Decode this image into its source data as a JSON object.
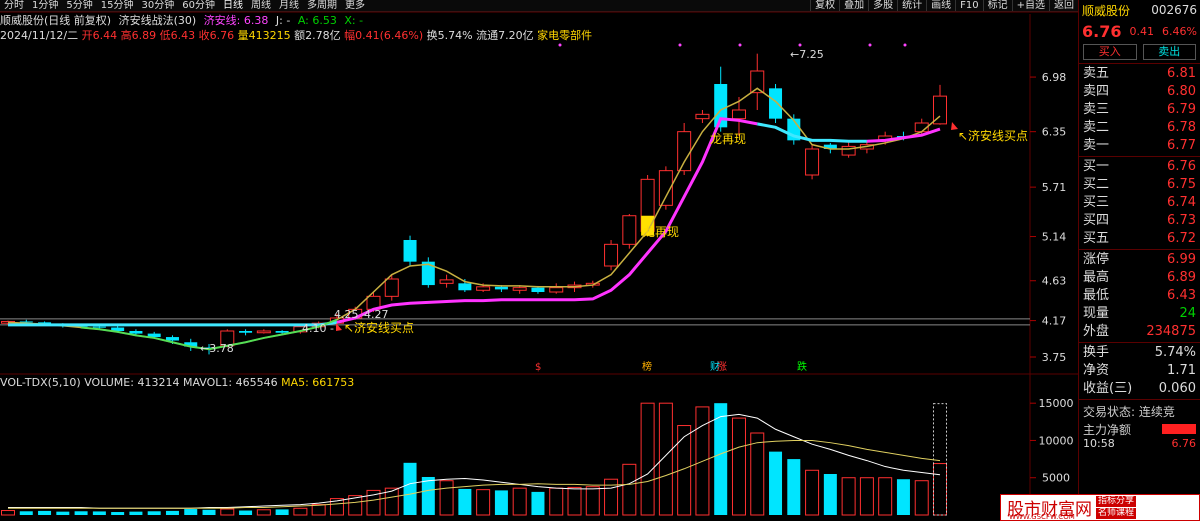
{
  "menu": {
    "tabs": [
      "分时",
      "1分钟",
      "5分钟",
      "15分钟",
      "30分钟",
      "60分钟",
      "日线",
      "周线",
      "月线",
      "多周期",
      "更多"
    ],
    "active": "日线",
    "right": [
      "复权",
      "叠加",
      "多股",
      "统计",
      "画线",
      "F10",
      "标记",
      "+自选",
      "返回"
    ]
  },
  "title": {
    "name": "顺威股份(日线 前复权)",
    "indicator": "济安线战法(30)",
    "jax_label": "济安线: 6.38",
    "j_label": "J: -",
    "a_label": "A: 6.53",
    "x_label": "X: -"
  },
  "info": {
    "date": "2024/11/12/二",
    "open": "开6.44",
    "high": "高6.89",
    "low": "低6.43",
    "close": "收6.76",
    "vol": "量413215",
    "amount": "额2.78亿",
    "change": "幅0.41(6.46%)",
    "turnover": "换5.74%",
    "float": "流通7.20亿",
    "sector": "家电零部件"
  },
  "vol_info": {
    "name": "VOL-TDX(5,10)",
    "volume": "VOLUME: 413214",
    "mavol1": "MAVOL1: 465546",
    "ma5": "MA5: 661753"
  },
  "colors": {
    "up": "#ff3030",
    "down": "#00e5ff",
    "jax": "#ff33ff",
    "ma": "#aaffaa",
    "green": "#33cc33",
    "grid": "#5a0000"
  },
  "chart_data": {
    "type": "candlestick",
    "price_ticks": [
      "6.98",
      "6.35",
      "5.71",
      "5.14",
      "4.63",
      "4.17",
      "3.75"
    ],
    "vol_ticks": [
      "15000",
      "10000",
      "5000"
    ],
    "annotations": {
      "high": "7.25",
      "low": "3.78",
      "mid1": "4.25",
      "mid2": "4.27",
      "low2": "4.10",
      "buy1": "济安线买点",
      "buy2": "济安线买点",
      "dragon1": "龙再现",
      "dragon2": "龙再现"
    },
    "event_marks": [
      {
        "t": "$",
        "c": "#ff3030"
      },
      {
        "t": "榜",
        "c": "#ffb000"
      },
      {
        "t": "财",
        "c": "#00e5ff"
      },
      {
        "t": "涨",
        "c": "#ff3030"
      },
      {
        "t": "跌",
        "c": "#00ff00"
      }
    ],
    "candles": [
      [
        4.14,
        4.16,
        4.12,
        4.17
      ],
      [
        4.16,
        4.15,
        4.13,
        4.18
      ],
      [
        4.15,
        4.13,
        4.11,
        4.16
      ],
      [
        4.13,
        4.11,
        4.09,
        4.14
      ],
      [
        4.11,
        4.1,
        4.08,
        4.13
      ],
      [
        4.1,
        4.09,
        4.07,
        4.12
      ],
      [
        4.09,
        4.05,
        4.04,
        4.11
      ],
      [
        4.05,
        4.02,
        4.0,
        4.07
      ],
      [
        4.02,
        3.98,
        3.97,
        4.04
      ],
      [
        3.98,
        3.94,
        3.9,
        4.0
      ],
      [
        3.92,
        3.87,
        3.82,
        3.96
      ],
      [
        3.86,
        3.84,
        3.78,
        3.9
      ],
      [
        3.88,
        4.05,
        3.86,
        4.07
      ],
      [
        4.05,
        4.03,
        4.0,
        4.07
      ],
      [
        4.03,
        4.05,
        4.02,
        4.07
      ],
      [
        4.05,
        4.03,
        4.01,
        4.06
      ],
      [
        4.04,
        4.1,
        4.02,
        4.12
      ],
      [
        4.1,
        4.14,
        4.08,
        4.16
      ],
      [
        4.14,
        4.2,
        4.1,
        4.25
      ],
      [
        4.2,
        4.3,
        4.18,
        4.33
      ],
      [
        4.3,
        4.45,
        4.27,
        4.5
      ],
      [
        4.45,
        4.65,
        4.4,
        4.7
      ],
      [
        5.1,
        4.85,
        4.8,
        5.15
      ],
      [
        4.85,
        4.58,
        4.55,
        4.9
      ],
      [
        4.6,
        4.64,
        4.55,
        4.7
      ],
      [
        4.6,
        4.52,
        4.5,
        4.65
      ],
      [
        4.52,
        4.56,
        4.5,
        4.6
      ],
      [
        4.56,
        4.53,
        4.5,
        4.58
      ],
      [
        4.52,
        4.55,
        4.48,
        4.58
      ],
      [
        4.55,
        4.5,
        4.48,
        4.57
      ],
      [
        4.5,
        4.55,
        4.48,
        4.6
      ],
      [
        4.55,
        4.58,
        4.5,
        4.62
      ],
      [
        4.58,
        4.6,
        4.55,
        4.63
      ],
      [
        4.8,
        5.05,
        4.75,
        5.1
      ],
      [
        5.05,
        5.38,
        5.0,
        5.4
      ],
      [
        5.2,
        5.8,
        5.15,
        5.85
      ],
      [
        5.5,
        5.9,
        5.45,
        5.95
      ],
      [
        5.9,
        6.35,
        5.85,
        6.45
      ],
      [
        6.5,
        6.55,
        6.45,
        6.6
      ],
      [
        6.9,
        6.4,
        6.35,
        7.1
      ],
      [
        6.5,
        6.6,
        6.3,
        6.75
      ],
      [
        6.8,
        7.05,
        6.6,
        7.25
      ],
      [
        6.85,
        6.5,
        6.45,
        6.9
      ],
      [
        6.5,
        6.25,
        6.2,
        6.55
      ],
      [
        5.85,
        6.15,
        5.8,
        6.2
      ],
      [
        6.2,
        6.15,
        6.1,
        6.22
      ],
      [
        6.08,
        6.18,
        6.05,
        6.25
      ],
      [
        6.15,
        6.2,
        6.1,
        6.25
      ],
      [
        6.25,
        6.3,
        6.2,
        6.35
      ],
      [
        6.3,
        6.28,
        6.25,
        6.35
      ],
      [
        6.35,
        6.45,
        6.3,
        6.5
      ],
      [
        6.44,
        6.76,
        6.43,
        6.89
      ]
    ],
    "jax": [
      4.12,
      4.12,
      4.12,
      4.12,
      4.12,
      4.12,
      4.12,
      4.12,
      4.12,
      4.12,
      4.12,
      4.12,
      4.12,
      4.12,
      4.12,
      4.12,
      4.12,
      4.12,
      4.15,
      4.2,
      4.3,
      4.35,
      4.37,
      4.38,
      4.39,
      4.4,
      4.4,
      4.41,
      4.41,
      4.41,
      4.41,
      4.41,
      4.42,
      4.52,
      4.7,
      4.95,
      5.2,
      5.6,
      6.0,
      6.5,
      6.48,
      6.44,
      6.4,
      6.3,
      6.25,
      6.25,
      6.24,
      6.24,
      6.25,
      6.28,
      6.31,
      6.38
    ],
    "ma": [
      4.15,
      4.14,
      4.13,
      4.11,
      4.09,
      4.07,
      4.04,
      4.0,
      3.97,
      3.92,
      3.87,
      3.84,
      3.88,
      3.92,
      3.97,
      4.01,
      4.05,
      4.1,
      4.18,
      4.3,
      4.5,
      4.7,
      4.8,
      4.82,
      4.74,
      4.62,
      4.58,
      4.57,
      4.57,
      4.56,
      4.56,
      4.56,
      4.58,
      4.7,
      4.95,
      5.2,
      5.6,
      6.0,
      6.35,
      6.6,
      6.7,
      6.85,
      6.7,
      6.48,
      6.2,
      6.15,
      6.15,
      6.18,
      6.22,
      6.27,
      6.35,
      6.53
    ],
    "volumes": [
      600,
      500,
      550,
      450,
      500,
      480,
      400,
      450,
      500,
      550,
      800,
      700,
      800,
      600,
      700,
      750,
      900,
      1400,
      2200,
      2600,
      3300,
      3600,
      7000,
      5100,
      4600,
      3500,
      3400,
      3300,
      3600,
      3100,
      3600,
      3700,
      3800,
      4800,
      6800,
      15000,
      15000,
      12000,
      14500,
      15000,
      13000,
      11000,
      8500,
      7500,
      6000,
      5500,
      5000,
      5000,
      5000,
      4800,
      4600,
      6900
    ],
    "mavol": [
      1000,
      1000,
      1000,
      1000,
      1000,
      900,
      900,
      900,
      900,
      900,
      900,
      1000,
      1000,
      1100,
      1200,
      1300,
      1400,
      1600,
      1900,
      2300,
      2700,
      3200,
      4200,
      4600,
      4800,
      4900,
      4700,
      4400,
      4100,
      3800,
      3600,
      3500,
      3500,
      3600,
      4200,
      5500,
      8000,
      10500,
      12000,
      13200,
      13500,
      13000,
      11500,
      10500,
      9500,
      8800,
      8000,
      7300,
      6500,
      6000,
      5700,
      5400
    ],
    "mavol2": [
      900,
      900,
      900,
      900,
      900,
      900,
      900,
      900,
      900,
      900,
      900,
      900,
      900,
      1000,
      1000,
      1100,
      1200,
      1300,
      1500,
      1700,
      2000,
      2400,
      2800,
      3300,
      3600,
      3800,
      4000,
      4100,
      4100,
      4200,
      4100,
      4100,
      4000,
      4000,
      4100,
      4500,
      5300,
      6200,
      7200,
      8200,
      9100,
      9700,
      9900,
      10000,
      10000,
      9700,
      9300,
      8800,
      8400,
      8000,
      7600,
      7300
    ]
  },
  "side": {
    "name": "顺威股份",
    "code": "002676",
    "price": "6.76",
    "chg": "0.41",
    "pct": "6.46%",
    "buy": "买入",
    "sell": "卖出",
    "asks": [
      [
        "卖五",
        "6.81"
      ],
      [
        "卖四",
        "6.80"
      ],
      [
        "卖三",
        "6.79"
      ],
      [
        "卖二",
        "6.78"
      ],
      [
        "卖一",
        "6.77"
      ]
    ],
    "bids": [
      [
        "买一",
        "6.76"
      ],
      [
        "买二",
        "6.75"
      ],
      [
        "买三",
        "6.74"
      ],
      [
        "买四",
        "6.73"
      ],
      [
        "买五",
        "6.72"
      ]
    ],
    "stats": [
      [
        "涨停",
        "6.99"
      ],
      [
        "最高",
        "6.89"
      ],
      [
        "最低",
        "6.43"
      ],
      [
        "现量",
        "24"
      ],
      [
        "外盘",
        "234875"
      ]
    ],
    "stats2": [
      [
        "换手",
        "5.74%"
      ],
      [
        "净资",
        "1.71"
      ],
      [
        "收益(三)",
        "0.060"
      ]
    ],
    "status": "交易状态: 连续竞",
    "net": "主力净额",
    "time": "10:58",
    "time_price": "6.76"
  },
  "watermark": {
    "main": "股市财富网",
    "tag1": "指标分享",
    "tag2": "名师课程",
    "url": "WWW.GSCFW.COM"
  }
}
